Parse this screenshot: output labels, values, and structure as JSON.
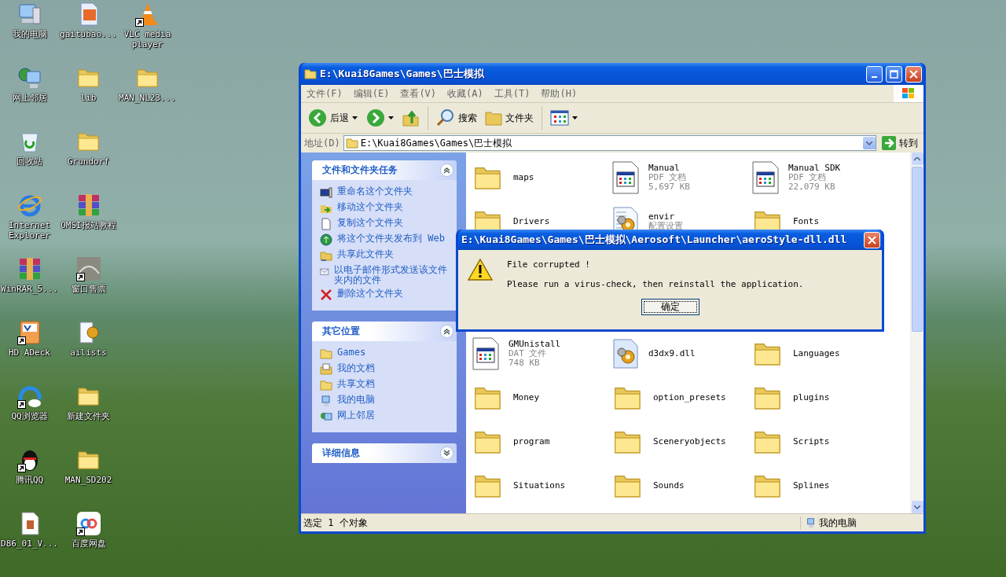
{
  "desktop": {
    "columns": [
      [
        {
          "label": "我的电脑",
          "kind": "computer",
          "shortcut": false
        },
        {
          "label": "网上邻居",
          "kind": "network",
          "shortcut": false
        },
        {
          "label": "回收站",
          "kind": "recycle",
          "shortcut": false
        },
        {
          "label": "Internet Explorer",
          "kind": "browser",
          "shortcut": false
        },
        {
          "label": "WinRAR_5...",
          "kind": "archive",
          "shortcut": false
        },
        {
          "label": "HD ADeck",
          "kind": "app",
          "shortcut": true
        },
        {
          "label": "QQ浏览器",
          "kind": "qqbrowser",
          "shortcut": true
        },
        {
          "label": "腾讯QQ",
          "kind": "penguin",
          "shortcut": true
        },
        {
          "label": "D86_01_V...",
          "kind": "file",
          "shortcut": false
        }
      ],
      [
        {
          "label": "gaitubao...",
          "kind": "image",
          "shortcut": false
        },
        {
          "label": "lib",
          "kind": "folder",
          "shortcut": false
        },
        {
          "label": "Grundorf",
          "kind": "folder",
          "shortcut": false
        },
        {
          "label": "OMSI报站教程",
          "kind": "archive",
          "shortcut": false
        },
        {
          "label": "窗口售票",
          "kind": "photo",
          "shortcut": true
        },
        {
          "label": "ailists",
          "kind": "config",
          "shortcut": false
        },
        {
          "label": "新建文件夹",
          "kind": "folder",
          "shortcut": false
        },
        {
          "label": "MAN_SD202",
          "kind": "folder",
          "shortcut": false
        },
        {
          "label": "百度网盘",
          "kind": "cloud",
          "shortcut": true
        }
      ],
      [
        {
          "label": "VLC media player",
          "kind": "cone",
          "shortcut": true
        },
        {
          "label": "MAN_NL23...",
          "kind": "folder",
          "shortcut": false
        }
      ]
    ]
  },
  "explorer": {
    "title": "E:\\Kuai8Games\\Games\\巴士模拟",
    "menu": [
      "文件(F)",
      "编辑(E)",
      "查看(V)",
      "收藏(A)",
      "工具(T)",
      "帮助(H)"
    ],
    "toolbar": {
      "back": "后退",
      "search": "搜索",
      "folders": "文件夹"
    },
    "address": {
      "label": "地址(D)",
      "value": "E:\\Kuai8Games\\Games\\巴士模拟",
      "go": "转到"
    },
    "left_pane": {
      "sections": [
        {
          "title": "文件和文件夹任务",
          "expanded": true,
          "items": [
            {
              "label": "重命名这个文件夹",
              "kind": "rename"
            },
            {
              "label": "移动这个文件夹",
              "kind": "move"
            },
            {
              "label": "复制这个文件夹",
              "kind": "copy"
            },
            {
              "label": "将这个文件夹发布到 Web",
              "kind": "globe"
            },
            {
              "label": "共享此文件夹",
              "kind": "share"
            },
            {
              "label": "以电子邮件形式发送该文件夹内的文件",
              "kind": "email"
            },
            {
              "label": "删除这个文件夹",
              "kind": "delete"
            }
          ]
        },
        {
          "title": "其它位置",
          "expanded": true,
          "items": [
            {
              "label": "Games",
              "kind": "folder"
            },
            {
              "label": "我的文档",
              "kind": "documents"
            },
            {
              "label": "共享文档",
              "kind": "folder"
            },
            {
              "label": "我的电脑",
              "kind": "computer"
            },
            {
              "label": "网上邻居",
              "kind": "network"
            }
          ]
        },
        {
          "title": "详细信息",
          "expanded": false
        }
      ]
    },
    "file_groups": [
      [
        {
          "name": "maps",
          "kind": "folder"
        },
        {
          "name": "Manual",
          "kind": "document",
          "type": "PDF 文档",
          "size": "5,697 KB"
        },
        {
          "name": "Manual SDK",
          "kind": "document",
          "type": "PDF 文档",
          "size": "22,079 KB"
        },
        {
          "name": "Drivers",
          "kind": "folder"
        },
        {
          "name": "envir",
          "kind": "config",
          "type": "配置设置"
        },
        {
          "name": "Fonts",
          "kind": "folder"
        }
      ],
      [
        {
          "name": "GMUnistall",
          "kind": "document",
          "type": "DAT 文件",
          "size": "748 KB"
        },
        {
          "name": "d3dx9.dll",
          "kind": "library"
        },
        {
          "name": "Languages",
          "kind": "folder"
        },
        {
          "name": "Money",
          "kind": "folder"
        },
        {
          "name": "option_presets",
          "kind": "folder"
        },
        {
          "name": "plugins",
          "kind": "folder"
        },
        {
          "name": "program",
          "kind": "folder"
        },
        {
          "name": "Sceneryobjects",
          "kind": "folder"
        },
        {
          "name": "Scripts",
          "kind": "folder"
        },
        {
          "name": "Situations",
          "kind": "folder"
        },
        {
          "name": "Sounds",
          "kind": "folder"
        },
        {
          "name": "Splines",
          "kind": "folder"
        }
      ]
    ],
    "status_bar": {
      "selection": "选定 1 个对象",
      "location": "我的电脑"
    }
  },
  "dialog": {
    "title": "E:\\Kuai8Games\\Games\\巴士模拟\\Aerosoft\\Launcher\\aeroStyle-dll.dll",
    "kind": "warning",
    "lines": [
      "File corrupted !",
      "Please run a virus-check, then reinstall the application."
    ],
    "button": "确定"
  }
}
